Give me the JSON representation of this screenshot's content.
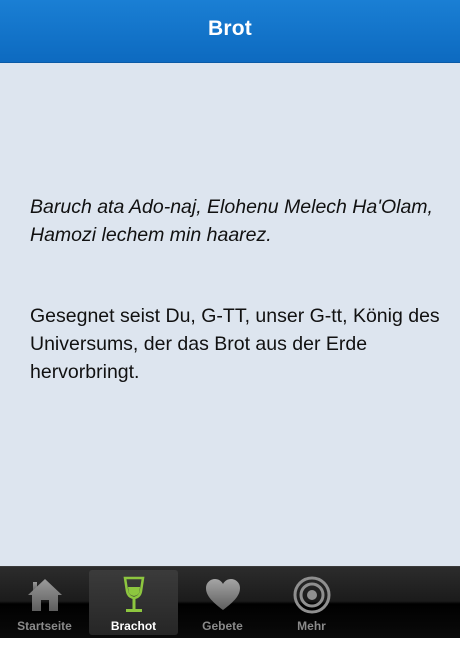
{
  "header": {
    "title": "Brot"
  },
  "content": {
    "hebrew_transliteration": "Baruch ata Ado-naj, Elohenu Melech Ha'Olam, Hamozi lechem min haarez.",
    "german_translation": "Gesegnet seist Du, G-TT, unser G-tt, König des Universums, der das Brot aus der Erde hervorbringt."
  },
  "tabbar": {
    "tabs": [
      {
        "label": "Startseite",
        "icon": "home-icon",
        "active": false
      },
      {
        "label": "Brachot",
        "icon": "goblet-icon",
        "active": true
      },
      {
        "label": "Gebete",
        "icon": "heart-icon",
        "active": false
      },
      {
        "label": "Mehr",
        "icon": "target-icon",
        "active": false
      }
    ]
  },
  "colors": {
    "header_blue": "#0d6ac0",
    "content_bg": "#dde5ef",
    "active_icon_green": "#8dc63f"
  }
}
